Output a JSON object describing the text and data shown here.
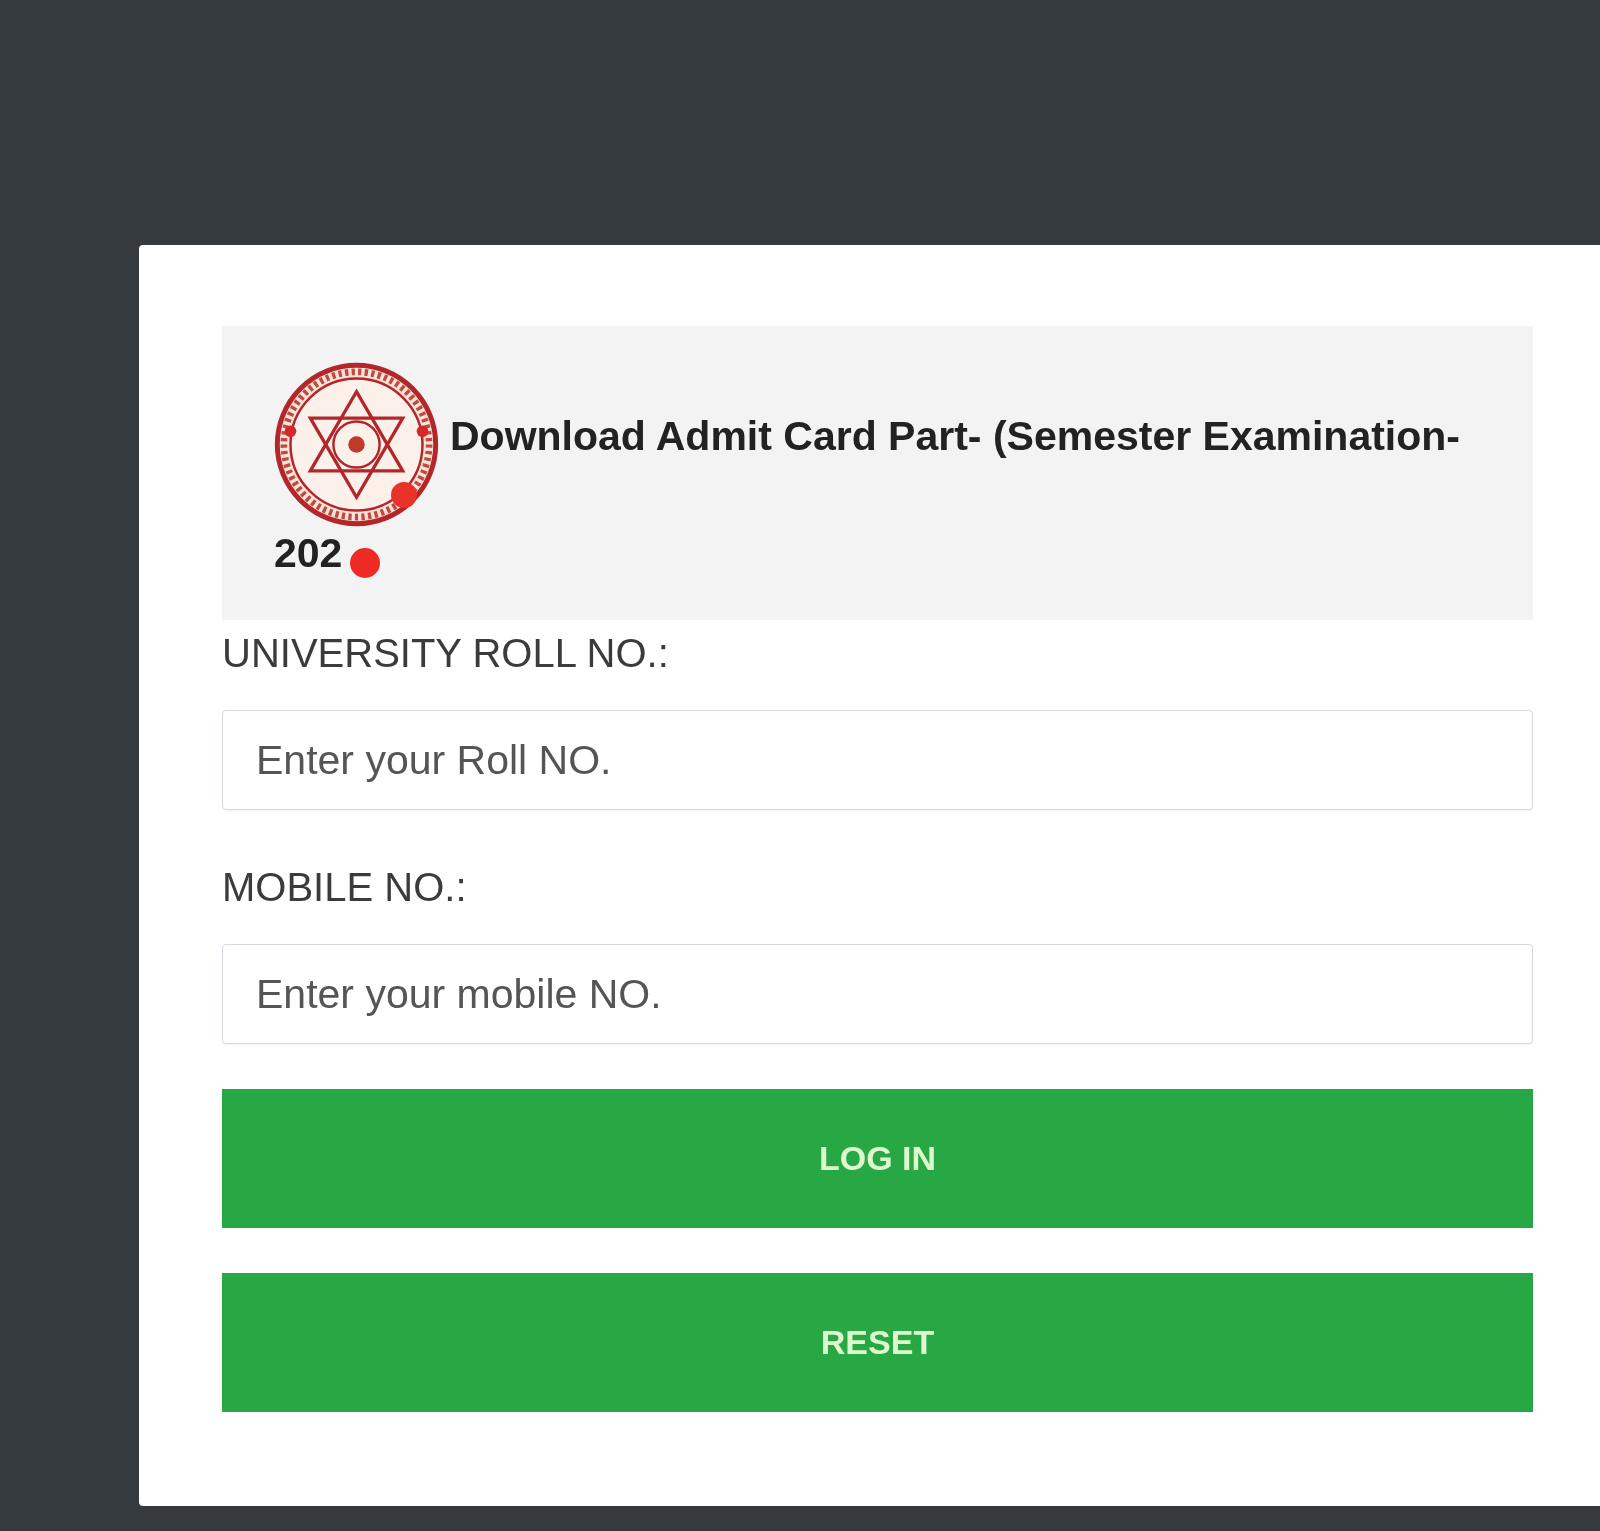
{
  "header": {
    "title_lines": [
      "Download Admit Card Part- (Semester Examination-",
      "202"
    ]
  },
  "form": {
    "fields": [
      {
        "label": "UNIVERSITY ROLL NO.:",
        "placeholder": "Enter your Roll NO."
      },
      {
        "label": "MOBILE NO.:",
        "placeholder": "Enter your mobile NO."
      }
    ],
    "buttons": [
      "LOG IN",
      "RESET"
    ]
  }
}
